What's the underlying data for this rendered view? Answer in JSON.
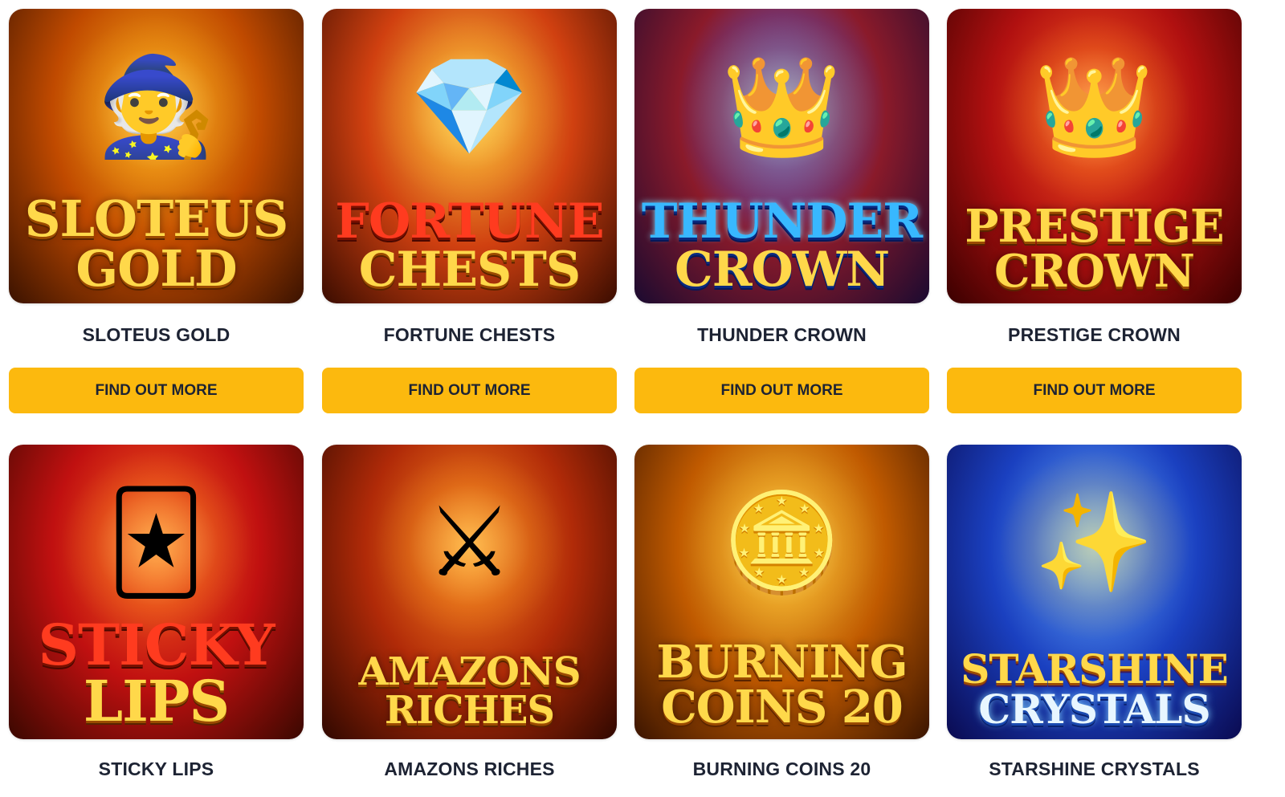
{
  "theme": {
    "button_color": "#fcb90e",
    "title_color": "#1d2333",
    "background": "#ffffff"
  },
  "games": [
    {
      "title": "SLOTEUS GOLD",
      "logo_lines": [
        "SLOTEUS",
        "GOLD"
      ],
      "button": "FIND OUT MORE",
      "art": {
        "emblem": "🧙",
        "colors": [
          "#ffb21a",
          "#c04a00",
          "#3a1200"
        ]
      }
    },
    {
      "title": "FORTUNE CHESTS",
      "logo_lines": [
        "FORTUNE",
        "CHESTS"
      ],
      "button": "FIND OUT MORE",
      "art": {
        "emblem": "💎",
        "colors": [
          "#ffcc40",
          "#d04010",
          "#3a0c00"
        ]
      }
    },
    {
      "title": "THUNDER CROWN",
      "logo_lines": [
        "THUNDER",
        "CROWN"
      ],
      "button": "FIND OUT MORE",
      "art": {
        "emblem": "👑",
        "colors": [
          "#4a6bff",
          "#8a1a2a",
          "#1a0a30"
        ]
      }
    },
    {
      "title": "PRESTIGE CROWN",
      "logo_lines": [
        "PRESTIGE",
        "CROWN"
      ],
      "button": "FIND OUT MORE",
      "art": {
        "emblem": "👑",
        "colors": [
          "#ff5a20",
          "#b01010",
          "#3a0000"
        ]
      }
    },
    {
      "title": "STICKY LIPS",
      "logo_lines": [
        "STICKY",
        "LIPS"
      ],
      "button": null,
      "art": {
        "emblem": "🃏",
        "colors": [
          "#ff6a20",
          "#c01010",
          "#3a0800"
        ]
      }
    },
    {
      "title": "AMAZONS RICHES",
      "logo_lines": [
        "AMAZONS",
        "RICHES"
      ],
      "button": null,
      "art": {
        "emblem": "⚔",
        "colors": [
          "#ff8a20",
          "#b02a08",
          "#300800"
        ]
      }
    },
    {
      "title": "BURNING COINS 20",
      "logo_lines": [
        "BURNING",
        "COINS 20"
      ],
      "button": null,
      "art": {
        "emblem": "🪙",
        "colors": [
          "#ffd040",
          "#c05a00",
          "#3a1400"
        ]
      }
    },
    {
      "title": "STARSHINE CRYSTALS",
      "logo_lines": [
        "STARSHINE",
        "CRYSTALS"
      ],
      "button": null,
      "art": {
        "emblem": "✨",
        "colors": [
          "#6ab0ff",
          "#1a40c0",
          "#0a0a50"
        ]
      }
    }
  ]
}
